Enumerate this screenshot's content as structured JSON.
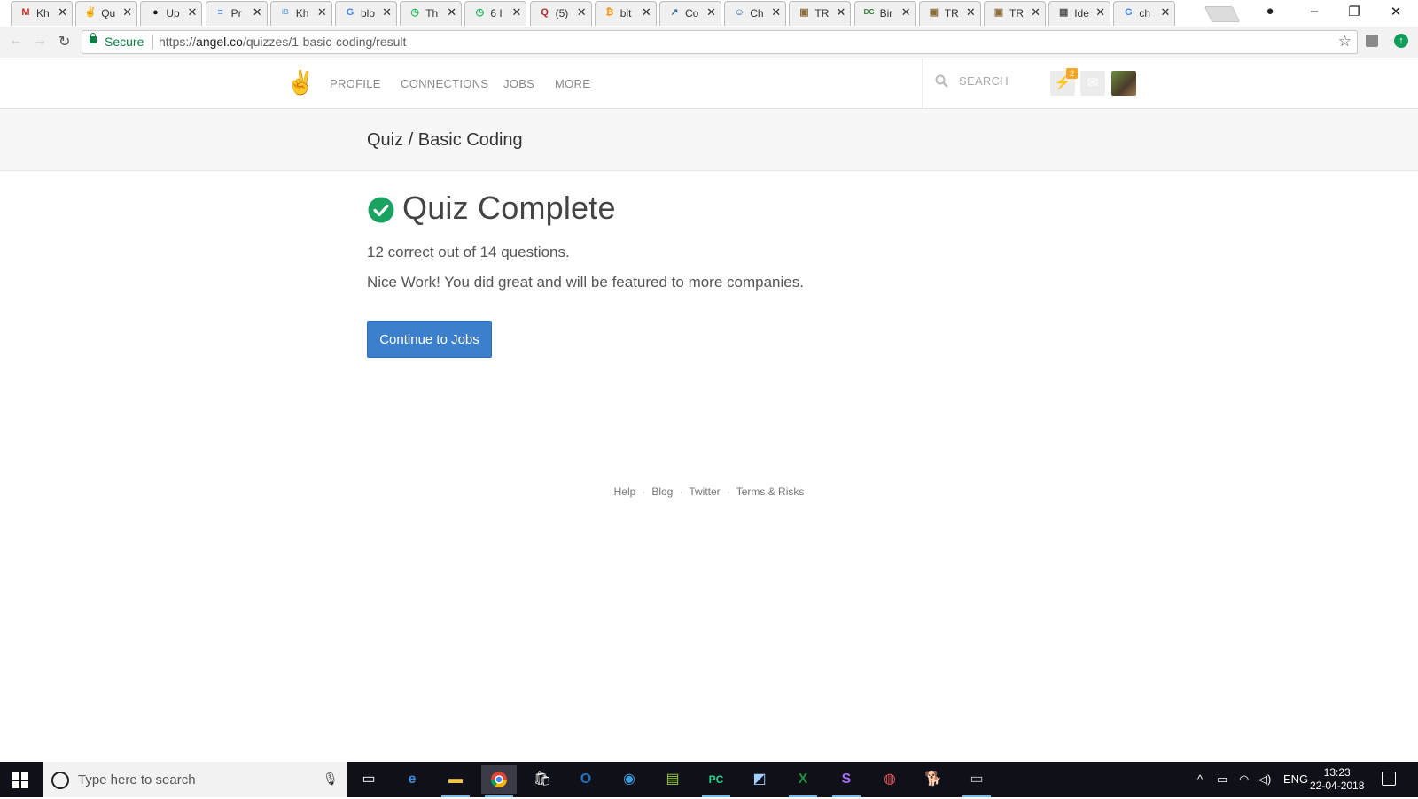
{
  "browser": {
    "tabs": [
      {
        "title": "Kh",
        "favicon": "gmail-icon",
        "color": "#d93025",
        "glyph": "M"
      },
      {
        "title": "Qu",
        "favicon": "angellist-icon",
        "color": "#222222",
        "glyph": "✌",
        "active": true
      },
      {
        "title": "Up",
        "favicon": "github-icon",
        "color": "#111111",
        "glyph": "●"
      },
      {
        "title": "Pr",
        "favicon": "google-docs-icon",
        "color": "#4285f4",
        "glyph": "≡"
      },
      {
        "title": "Kh",
        "favicon": "ib-icon",
        "color": "#6fa8dc",
        "glyph": "iB"
      },
      {
        "title": "blo",
        "favicon": "google-icon",
        "color": "#4285f4",
        "glyph": "G"
      },
      {
        "title": "Th",
        "favicon": "timer-icon",
        "color": "#1db954",
        "glyph": "◷"
      },
      {
        "title": "6 I",
        "favicon": "timer-icon",
        "color": "#1db954",
        "glyph": "◷"
      },
      {
        "title": "(5)",
        "favicon": "quora-icon",
        "color": "#b92b27",
        "glyph": "Q"
      },
      {
        "title": "bit",
        "favicon": "bitcoin-icon",
        "color": "#f7931a",
        "glyph": "₿"
      },
      {
        "title": "Co",
        "favicon": "chart-icon",
        "color": "#3a6ea5",
        "glyph": "↗"
      },
      {
        "title": "Ch",
        "favicon": "people-icon",
        "color": "#1f5fa8",
        "glyph": "☺"
      },
      {
        "title": "TR",
        "favicon": "image-icon",
        "color": "#8a6d3b",
        "glyph": "▣"
      },
      {
        "title": "Bir",
        "favicon": "dg-icon",
        "color": "#2e7d32",
        "glyph": "DG"
      },
      {
        "title": "TR",
        "favicon": "image-icon",
        "color": "#8a6d3b",
        "glyph": "▣"
      },
      {
        "title": "TR",
        "favicon": "image-icon",
        "color": "#8a6d3b",
        "glyph": "▣"
      },
      {
        "title": "Ide",
        "favicon": "ide-icon",
        "color": "#555555",
        "glyph": "▦"
      },
      {
        "title": "ch",
        "favicon": "google-icon",
        "color": "#4285f4",
        "glyph": "G"
      }
    ],
    "secure_label": "Secure",
    "url_scheme": "https://",
    "url_host": "angel.co",
    "url_path": "/quizzes/1-basic-coding/result"
  },
  "header": {
    "nav": [
      "PROFILE",
      "CONNECTIONS",
      "JOBS",
      "MORE"
    ],
    "search_placeholder": "SEARCH",
    "notification_count": "2"
  },
  "breadcrumb": "Quiz / Basic Coding",
  "result": {
    "heading": "Quiz Complete",
    "score_text": "12 correct out of 14 questions.",
    "message": "Nice Work! You did great and will be featured to more companies.",
    "cta_label": "Continue to Jobs"
  },
  "footer": {
    "links": [
      "Help",
      "Blog",
      "Twitter",
      "Terms & Risks"
    ]
  },
  "taskbar": {
    "search_placeholder": "Type here to search",
    "language": "ENG",
    "time": "13:23",
    "date": "22-04-2018"
  },
  "colors": {
    "accent": "#3b7fcd",
    "success": "#1aa260",
    "badge": "#f5a623"
  }
}
